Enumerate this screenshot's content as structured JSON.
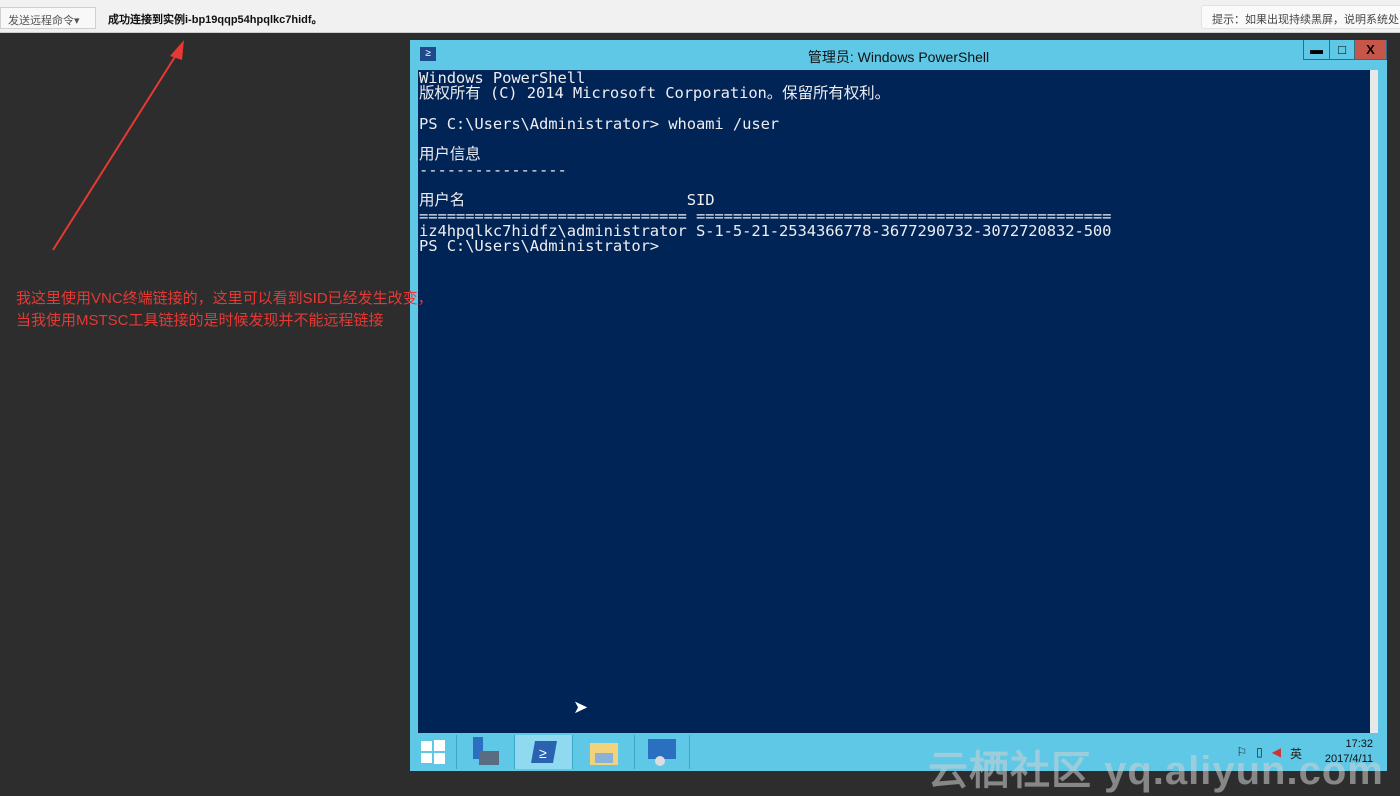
{
  "topbar": {
    "send_command": "发送远程命令▾",
    "status": "成功连接到实例i-bp19qqp54hpqlkc7hidf。",
    "hint": "提示：如果出现持续黑屏，说明系统处"
  },
  "window": {
    "title": "管理员: Windows PowerShell",
    "minimize": "▬",
    "maximize": "□",
    "close": "X"
  },
  "console": {
    "lines": [
      "Windows PowerShell",
      "版权所有 (C) 2014 Microsoft Corporation。保留所有权利。",
      "",
      "PS C:\\Users\\Administrator> whoami /user",
      "",
      "用户信息",
      "----------------",
      "",
      "用户名                        SID",
      "============================= =============================================",
      "iz4hpqlkc7hidfz\\administrator S-1-5-21-2534366778-3677290732-3072720832-500",
      "PS C:\\Users\\Administrator>"
    ]
  },
  "taskbar": {
    "time": "17:32",
    "date": "2017/4/11",
    "ime": "英"
  },
  "annotation": {
    "line1": "我这里使用VNC终端链接的，这里可以看到SID已经发生改变，",
    "line2": "当我使用MSTSC工具链接的是时候发现并不能远程链接"
  },
  "watermark": "云栖社区 yq.aliyun.com"
}
